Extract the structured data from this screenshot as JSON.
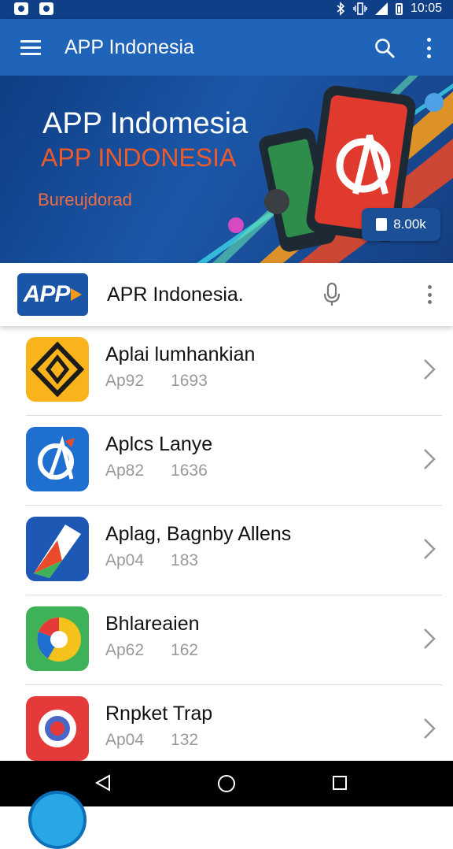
{
  "status_bar": {
    "time": "10:05",
    "icons": [
      "notification-icon",
      "image-notification-icon",
      "bluetooth-icon",
      "vibrate-icon",
      "signal-icon",
      "battery-icon"
    ]
  },
  "app_bar": {
    "title": "APP Indonesia",
    "icons": [
      "menu-icon",
      "search-icon",
      "more-vert-icon"
    ]
  },
  "banner": {
    "title": "APP Indomesia",
    "subtitle": "APP INDONESIA",
    "caption": "Bureujdorad",
    "button_label": "8.00k",
    "colors": {
      "accent": "#ef5a2a",
      "background": "#1b57a8"
    }
  },
  "search_card": {
    "logo_text": "APP",
    "query": "APR Indonesia.",
    "icons": [
      "mic-icon",
      "more-vert-icon"
    ]
  },
  "apps": [
    {
      "name": "Aplai lumhankian",
      "category": "Ap92",
      "count": "1693",
      "icon_color": "#f9b41b"
    },
    {
      "name": "Aplcs Lanye",
      "category": "Ap82",
      "count": "1636",
      "icon_color": "#1f6fd1"
    },
    {
      "name": "Aplag, Bagnby Allens",
      "category": "Ap04",
      "count": "183",
      "icon_color": "#1d58b5"
    },
    {
      "name": "Bhlareaien",
      "category": "Ap62",
      "count": "162",
      "icon_color": "#3fb259"
    },
    {
      "name": "Rnpket Trap",
      "category": "Ap04",
      "count": "132",
      "icon_color": "#e53a3a"
    }
  ],
  "nav_bar": {
    "icons": [
      "back-icon",
      "home-icon",
      "recents-icon"
    ]
  }
}
